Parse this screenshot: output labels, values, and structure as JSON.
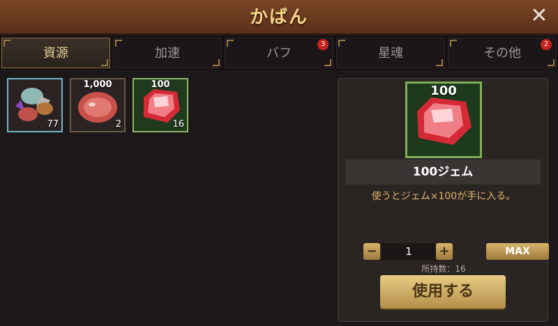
{
  "header": {
    "title": "かばん",
    "close_label": "✕"
  },
  "tabs": [
    {
      "label": "資源",
      "badge": "",
      "active": true
    },
    {
      "label": "加速",
      "badge": "",
      "active": false
    },
    {
      "label": "バフ",
      "badge": "3",
      "active": false
    },
    {
      "label": "星魂",
      "badge": "",
      "active": false
    },
    {
      "label": "その他",
      "badge": "2",
      "active": false
    }
  ],
  "items": [
    {
      "top_label": "",
      "count": "77",
      "icon": "resource-bundle-icon"
    },
    {
      "top_label": "1,000",
      "count": "2",
      "icon": "meat-icon"
    },
    {
      "top_label": "100",
      "count": "16",
      "icon": "ruby-gem-icon",
      "selected": true
    }
  ],
  "detail": {
    "icon_label": "100",
    "name": "100ジェム",
    "description": "使うとジェム×100が手に入る。",
    "quantity": "1",
    "minus_label": "−",
    "plus_label": "+",
    "max_label": "MAX",
    "owned_text": "所持数：16",
    "use_label": "使用する"
  },
  "colors": {
    "accent_gold": "#e7cf9a",
    "selected_green": "#8fb66a",
    "badge_red": "#c8231e"
  }
}
